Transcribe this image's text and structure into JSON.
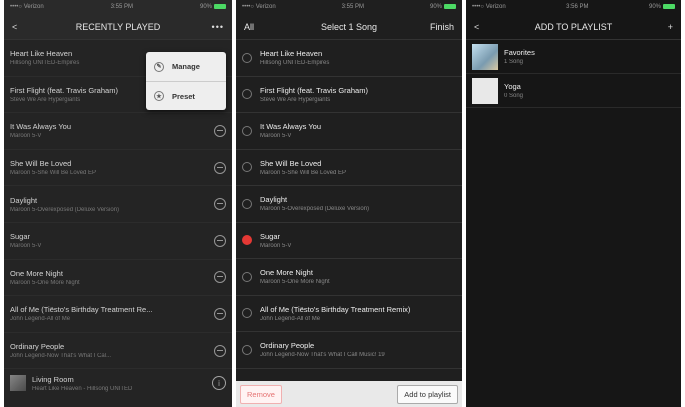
{
  "panel1": {
    "status": {
      "carrier": "••••○ Verizon",
      "time": "3:55 PM",
      "battery": "90%"
    },
    "nav": {
      "back": "<",
      "title": "RECENTLY PLAYED",
      "more": "•••"
    },
    "menu": [
      {
        "icon": "manage-icon",
        "label": "Manage"
      },
      {
        "icon": "preset-icon",
        "label": "Preset"
      }
    ],
    "songs": [
      {
        "title": "Heart Like Heaven",
        "subtitle": "Hillsong UNITED-Empires"
      },
      {
        "title": "First Flight (feat. Travis Graham)",
        "subtitle": "Steve We Are Hypergiants"
      },
      {
        "title": "It Was Always You",
        "subtitle": "Maroon 5-V"
      },
      {
        "title": "She Will Be Loved",
        "subtitle": "Maroon 5-She Will Be Loved EP"
      },
      {
        "title": "Daylight",
        "subtitle": "Maroon 5-Overexposed (Deluxe Version)"
      },
      {
        "title": "Sugar",
        "subtitle": "Maroon 5-V"
      },
      {
        "title": "One More Night",
        "subtitle": "Maroon 5-One More Night"
      },
      {
        "title": "All of Me (Tiësto's Birthday Treatment Re...",
        "subtitle": "John Legend-All of Me"
      },
      {
        "title": "Ordinary People",
        "subtitle": "John Legend-Now That's What I Cal..."
      }
    ],
    "now_playing": {
      "title": "Living Room",
      "subtitle": "Heart Like Heaven - Hillsong UNITED"
    }
  },
  "panel2": {
    "status": {
      "carrier": "••••○ Verizon",
      "time": "3:55 PM",
      "battery": "90%"
    },
    "nav": {
      "left": "All",
      "title": "Select 1 Song",
      "right": "Finish"
    },
    "songs": [
      {
        "title": "Heart Like Heaven",
        "subtitle": "Hillsong UNITED-Empires",
        "selected": false
      },
      {
        "title": "First Flight (feat. Travis Graham)",
        "subtitle": "Steve We Are Hypergiants",
        "selected": false
      },
      {
        "title": "It Was Always You",
        "subtitle": "Maroon 5-V",
        "selected": false
      },
      {
        "title": "She Will Be Loved",
        "subtitle": "Maroon 5-She Will Be Loved EP",
        "selected": false
      },
      {
        "title": "Daylight",
        "subtitle": "Maroon 5-Overexposed (Deluxe Version)",
        "selected": false
      },
      {
        "title": "Sugar",
        "subtitle": "Maroon 5-V",
        "selected": true
      },
      {
        "title": "One More Night",
        "subtitle": "Maroon 5-One More Night",
        "selected": false
      },
      {
        "title": "All of Me (Tiësto's Birthday Treatment Remix)",
        "subtitle": "John Legend-All of Me",
        "selected": false
      },
      {
        "title": "Ordinary People",
        "subtitle": "John Legend-Now That's What I Call Music! 19",
        "selected": false
      }
    ],
    "buttons": {
      "remove": "Remove",
      "add": "Add to playlist"
    }
  },
  "panel3": {
    "status": {
      "carrier": "••••○ Verizon",
      "time": "3:56 PM",
      "battery": "90%"
    },
    "nav": {
      "back": "<",
      "title": "ADD TO PLAYLIST",
      "plus": "+"
    },
    "playlists": [
      {
        "name": "Favorites",
        "count": "1 Song"
      },
      {
        "name": "Yoga",
        "count": "0 Song"
      }
    ]
  },
  "colors": {
    "accent_red": "#e53935",
    "battery_green": "#4cd964"
  }
}
